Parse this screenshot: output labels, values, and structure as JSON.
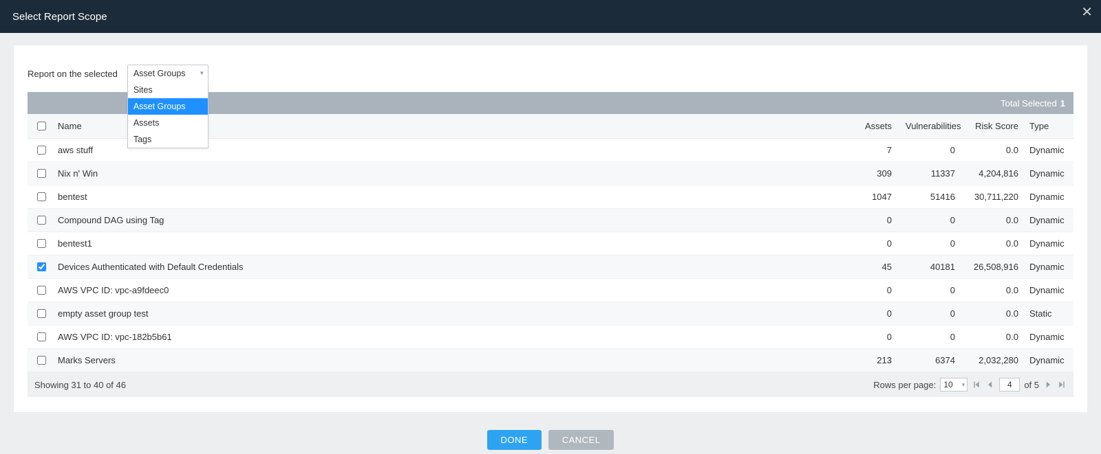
{
  "modal": {
    "title": "Select Report Scope"
  },
  "scope": {
    "label": "Report on the selected",
    "selected": "Asset Groups",
    "options": [
      "Sites",
      "Asset Groups",
      "Assets",
      "Tags"
    ]
  },
  "banner": {
    "label": "Total Selected",
    "count": "1"
  },
  "columns": {
    "name": "Name",
    "assets": "Assets",
    "vulns": "Vulnerabilities",
    "risk": "Risk Score",
    "type": "Type"
  },
  "rows": [
    {
      "checked": false,
      "name": "aws stuff",
      "assets": "7",
      "vulns": "0",
      "risk": "0.0",
      "type": "Dynamic"
    },
    {
      "checked": false,
      "name": "Nix n' Win",
      "assets": "309",
      "vulns": "11337",
      "risk": "4,204,816",
      "type": "Dynamic"
    },
    {
      "checked": false,
      "name": "bentest",
      "assets": "1047",
      "vulns": "51416",
      "risk": "30,711,220",
      "type": "Dynamic"
    },
    {
      "checked": false,
      "name": "Compound DAG using Tag",
      "assets": "0",
      "vulns": "0",
      "risk": "0.0",
      "type": "Dynamic"
    },
    {
      "checked": false,
      "name": "bentest1",
      "assets": "0",
      "vulns": "0",
      "risk": "0.0",
      "type": "Dynamic"
    },
    {
      "checked": true,
      "name": "Devices Authenticated with Default Credentials",
      "assets": "45",
      "vulns": "40181",
      "risk": "26,508,916",
      "type": "Dynamic"
    },
    {
      "checked": false,
      "name": "AWS VPC ID: vpc-a9fdeec0",
      "assets": "0",
      "vulns": "0",
      "risk": "0.0",
      "type": "Dynamic"
    },
    {
      "checked": false,
      "name": "empty asset group test",
      "assets": "0",
      "vulns": "0",
      "risk": "0.0",
      "type": "Static"
    },
    {
      "checked": false,
      "name": "AWS VPC ID: vpc-182b5b61",
      "assets": "0",
      "vulns": "0",
      "risk": "0.0",
      "type": "Dynamic"
    },
    {
      "checked": false,
      "name": "Marks Servers",
      "assets": "213",
      "vulns": "6374",
      "risk": "2,032,280",
      "type": "Dynamic"
    }
  ],
  "footer": {
    "status": "Showing 31 to 40 of 46",
    "rows_per_page_label": "Rows per page:",
    "rows_per_page_value": "10",
    "current_page": "4",
    "total_pages_label": "of 5"
  },
  "buttons": {
    "done": "DONE",
    "cancel": "CANCEL"
  }
}
